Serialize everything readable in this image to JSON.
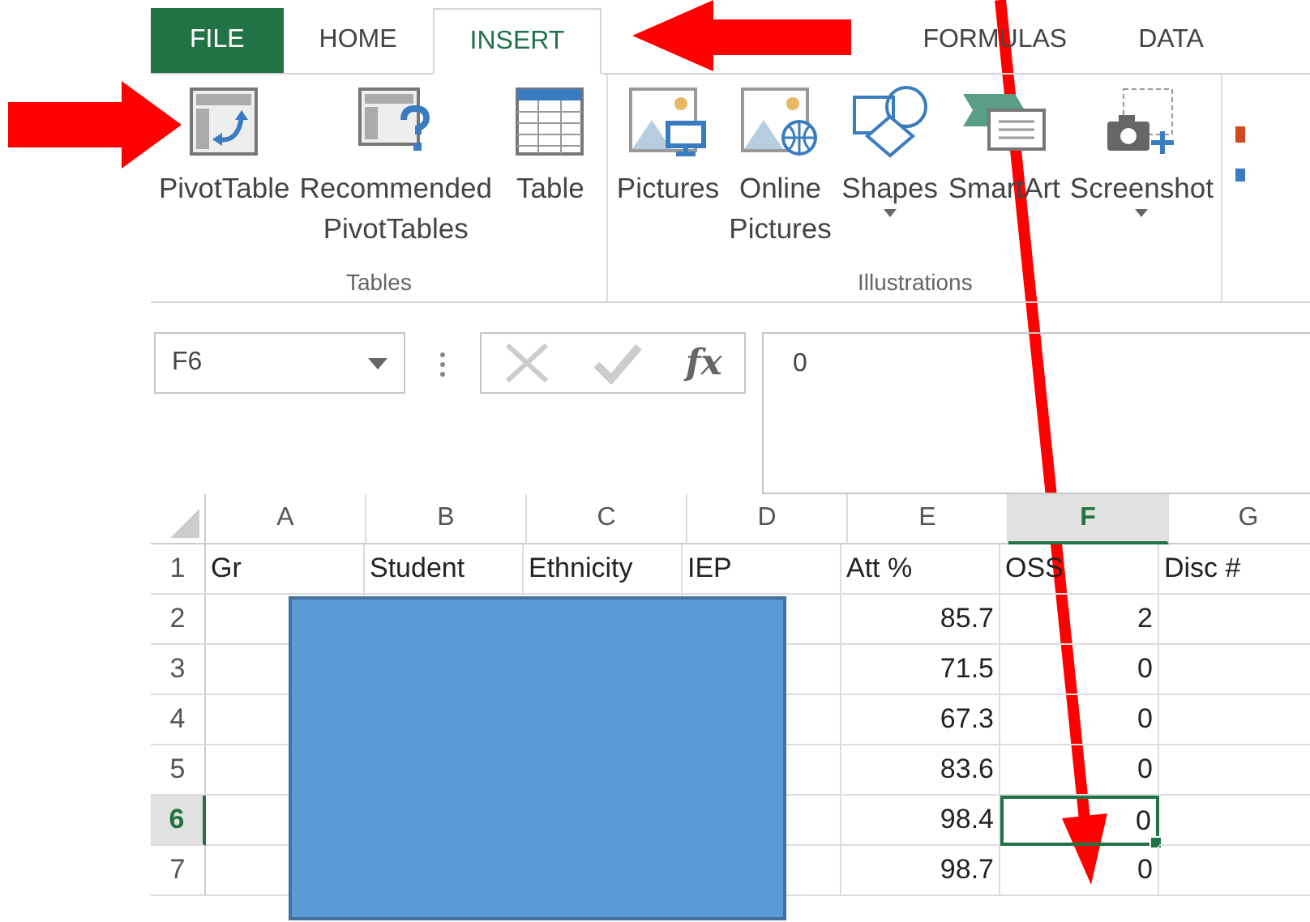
{
  "tabs": [
    {
      "label": "FILE",
      "kind": "file",
      "selected": false
    },
    {
      "label": "HOME",
      "kind": "tab",
      "selected": false
    },
    {
      "label": "INSERT",
      "kind": "tab",
      "selected": true
    },
    {
      "label": "FORMULAS",
      "kind": "tab",
      "selected": false
    },
    {
      "label": "DATA",
      "kind": "tab",
      "selected": false
    }
  ],
  "ribbon_groups": [
    {
      "label": "Tables",
      "buttons": [
        {
          "label": "PivotTable",
          "kind": "pivot",
          "dropdown": false
        },
        {
          "label": "Recommended PivotTables",
          "kind": "recommended",
          "dropdown": false
        },
        {
          "label": "Table",
          "kind": "table",
          "dropdown": false
        }
      ]
    },
    {
      "label": "Illustrations",
      "buttons": [
        {
          "label": "Pictures",
          "kind": "pictures",
          "dropdown": false
        },
        {
          "label": "Online Pictures",
          "kind": "online",
          "dropdown": false
        },
        {
          "label": "Shapes",
          "kind": "shapes",
          "dropdown": true
        },
        {
          "label": "SmartArt",
          "kind": "smartart",
          "dropdown": false
        },
        {
          "label": "Screenshot",
          "kind": "screenshot",
          "dropdown": true
        }
      ]
    }
  ],
  "name_box": {
    "value": "F6"
  },
  "formula_bar": {
    "function_button": "fx",
    "value": "0"
  },
  "columns": [
    {
      "label": "A",
      "selected": false
    },
    {
      "label": "B",
      "selected": false
    },
    {
      "label": "C",
      "selected": false
    },
    {
      "label": "D",
      "selected": false
    },
    {
      "label": "E",
      "selected": false
    },
    {
      "label": "F",
      "selected": true
    },
    {
      "label": "G",
      "selected": false
    }
  ],
  "rows": [
    {
      "header": "1",
      "selected": false,
      "cells": [
        {
          "value": "Gr",
          "selected": false
        },
        {
          "value": "Student",
          "selected": false
        },
        {
          "value": "Ethnicity",
          "selected": false
        },
        {
          "value": "IEP",
          "selected": false
        },
        {
          "value": "Att %",
          "selected": false
        },
        {
          "value": "OSS",
          "selected": false
        },
        {
          "value": "Disc #",
          "selected": false
        }
      ]
    },
    {
      "header": "2",
      "selected": false,
      "cells": [
        null,
        null,
        null,
        null,
        {
          "value": "85.7",
          "selected": false
        },
        {
          "value": "2",
          "selected": false
        },
        null
      ]
    },
    {
      "header": "3",
      "selected": false,
      "cells": [
        null,
        null,
        null,
        null,
        {
          "value": "71.5",
          "selected": false
        },
        {
          "value": "0",
          "selected": false
        },
        null
      ]
    },
    {
      "header": "4",
      "selected": false,
      "cells": [
        null,
        null,
        null,
        null,
        {
          "value": "67.3",
          "selected": false
        },
        {
          "value": "0",
          "selected": false
        },
        null
      ]
    },
    {
      "header": "5",
      "selected": false,
      "cells": [
        null,
        null,
        null,
        null,
        {
          "value": "83.6",
          "selected": false
        },
        {
          "value": "0",
          "selected": false
        },
        null
      ]
    },
    {
      "header": "6",
      "selected": true,
      "cells": [
        null,
        null,
        null,
        null,
        {
          "value": "98.4",
          "selected": false
        },
        {
          "value": "0",
          "selected": true
        },
        null
      ]
    },
    {
      "header": "7",
      "selected": false,
      "cells": [
        null,
        null,
        null,
        null,
        {
          "value": "98.7",
          "selected": false
        },
        {
          "value": "0",
          "selected": false
        },
        null
      ]
    }
  ]
}
